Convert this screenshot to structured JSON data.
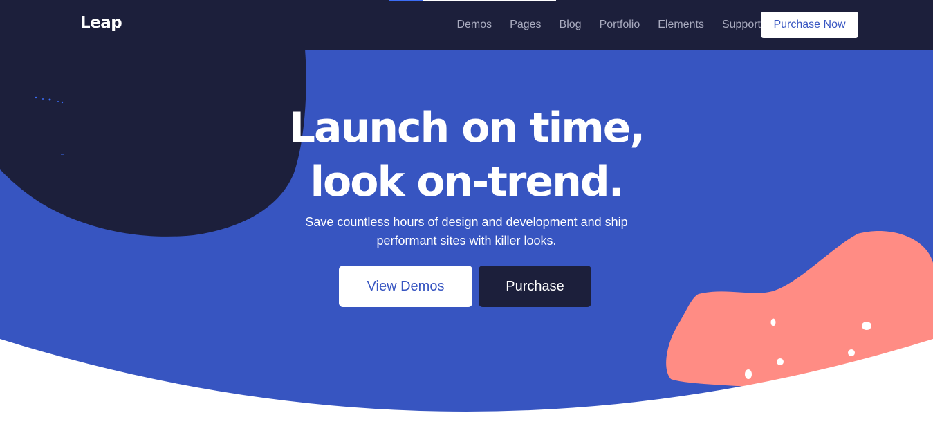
{
  "navbar": {
    "logo": "Leap",
    "links": [
      "Demos",
      "Pages",
      "Blog",
      "Portfolio",
      "Elements",
      "Support"
    ],
    "cta_label": "Purchase Now",
    "progress_fraction": 0.2
  },
  "hero": {
    "title_line1": "Launch on time,",
    "title_line2": "look on-trend.",
    "subtitle_line1": "Save countless hours of design and development and ship",
    "subtitle_line2": "performant sites with killer looks.",
    "primary_button": "View Demos",
    "secondary_button": "Purchase"
  },
  "colors": {
    "navbar_bg": "#1c1f3b",
    "hero_bg": "#3755c1",
    "dark_blob": "#1c1f3b",
    "coral_blob": "#ff8c84",
    "accent_text": "#3755c1"
  },
  "icons": {
    "dark_blob": "abstract-blob-shape",
    "coral_blob": "abstract-blob-shape"
  }
}
